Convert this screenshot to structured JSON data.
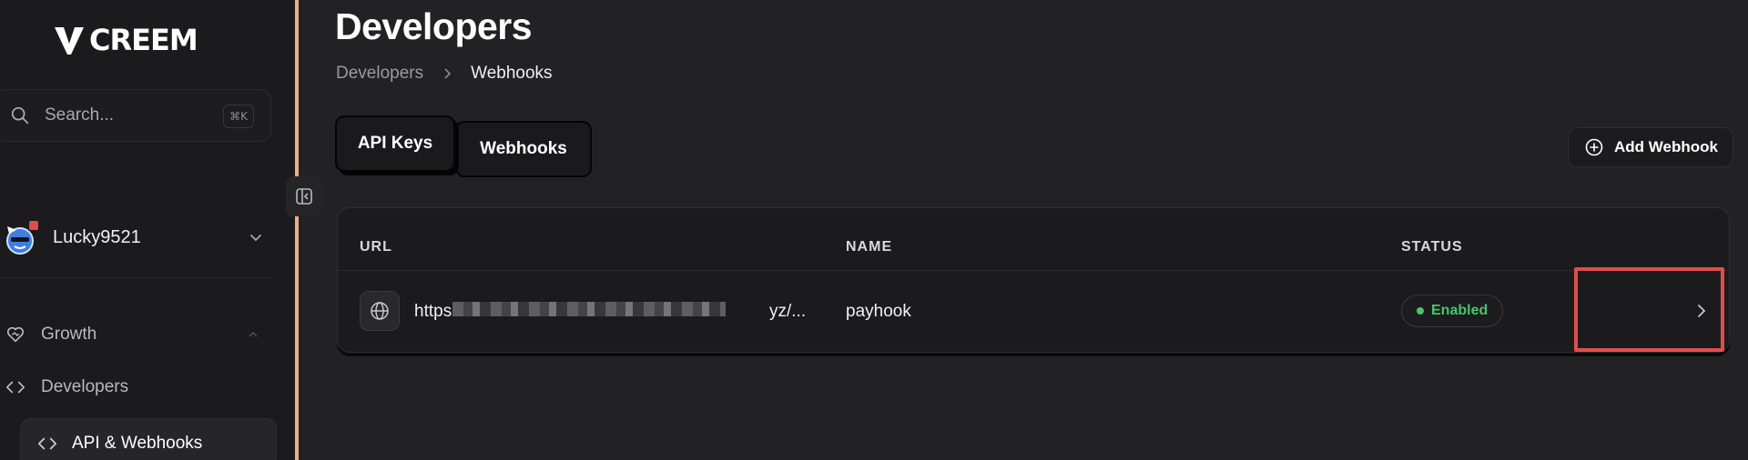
{
  "app": {
    "brand": "CREEM"
  },
  "sidebar": {
    "search": {
      "placeholder": "Search...",
      "shortcut": "⌘K"
    },
    "account": {
      "name": "Lucky9521"
    },
    "nav": {
      "growth": "Growth",
      "developers": "Developers",
      "api_webhooks": "API & Webhooks"
    }
  },
  "page": {
    "title": "Developers",
    "breadcrumb": {
      "parent": "Developers",
      "current": "Webhooks"
    },
    "tabs": [
      "API Keys",
      "Webhooks"
    ],
    "add_button": "Add Webhook"
  },
  "table": {
    "headers": {
      "url": "URL",
      "name": "NAME",
      "status": "STATUS"
    },
    "rows": [
      {
        "url_start": "https",
        "url_end": "yz/...",
        "name": "payhook",
        "status": "Enabled"
      }
    ]
  },
  "colors": {
    "accent_border": "#f0ad84",
    "status_enabled": "#49c46d",
    "highlight": "#e14d4d"
  }
}
